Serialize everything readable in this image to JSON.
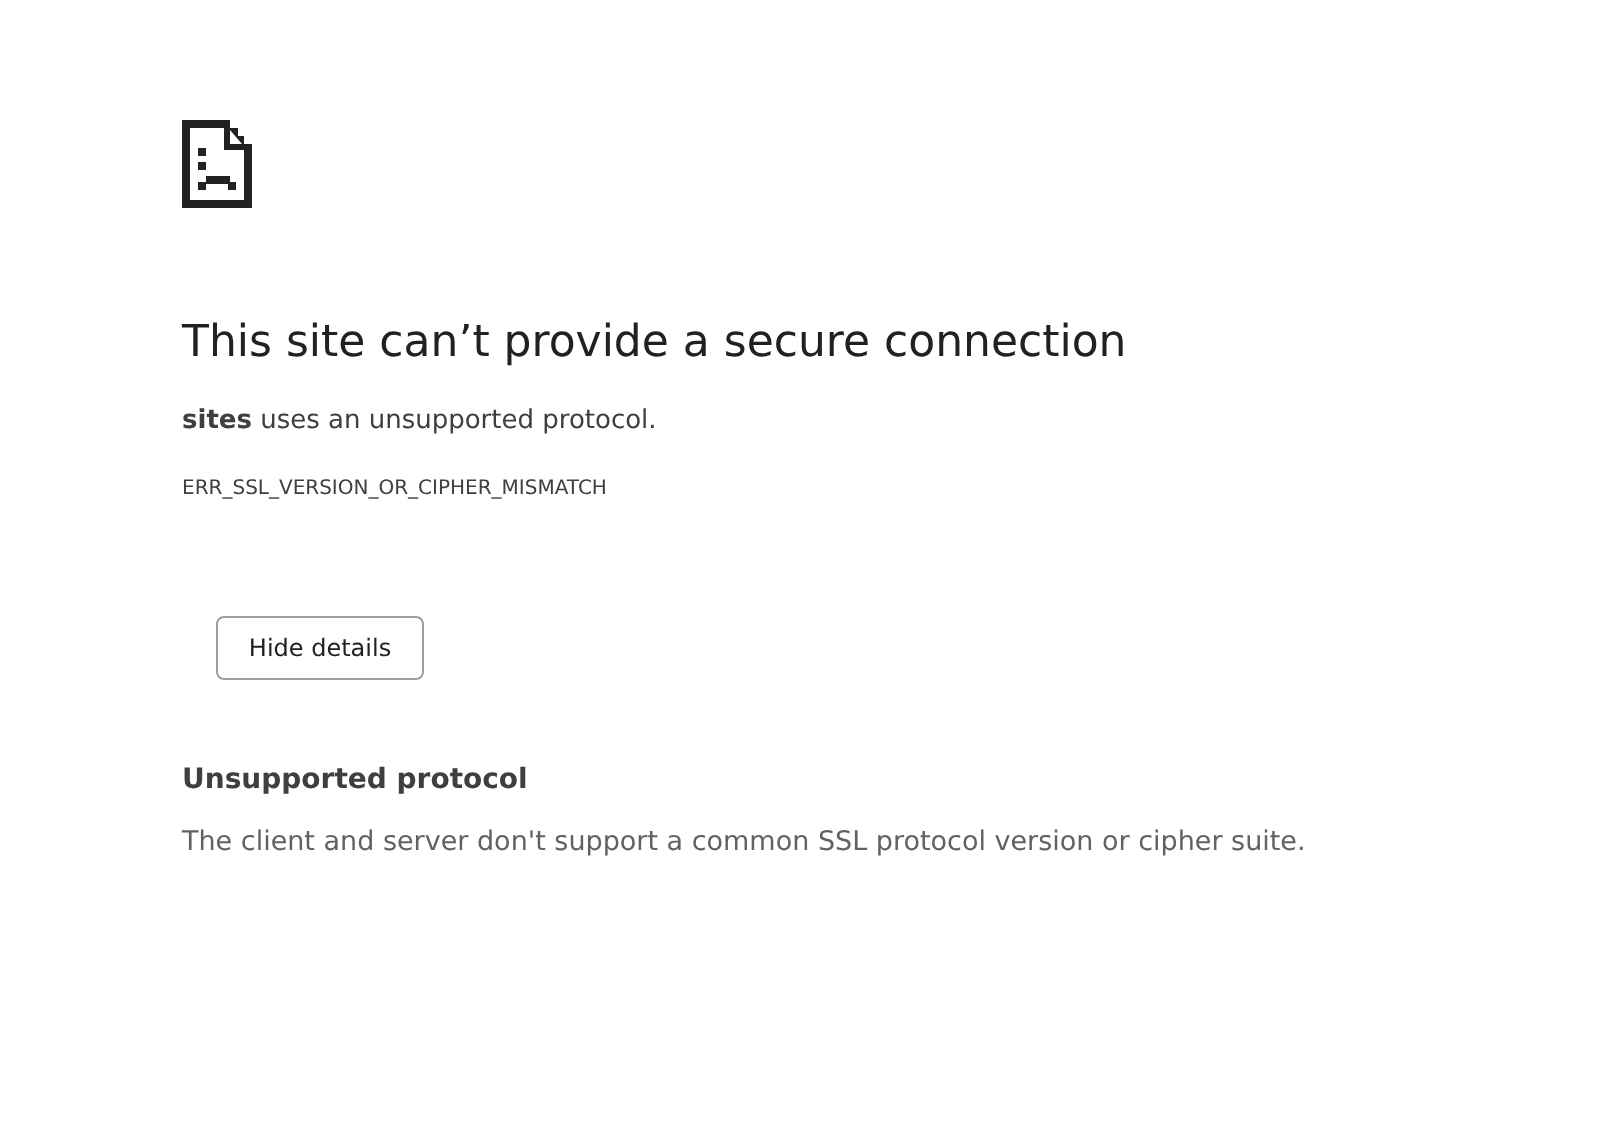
{
  "heading": "This site can’t provide a secure connection",
  "summary": "**sites** uses an unsupported protocol.",
  "error_code": "ERR_SSL_VERSION_OR_CIPHER_MISMATCH",
  "details_button": "Hide details",
  "details": {
    "title": "Unsupported protocol",
    "body": "The client and server don't support a common SSL protocol version or cipher suite."
  }
}
